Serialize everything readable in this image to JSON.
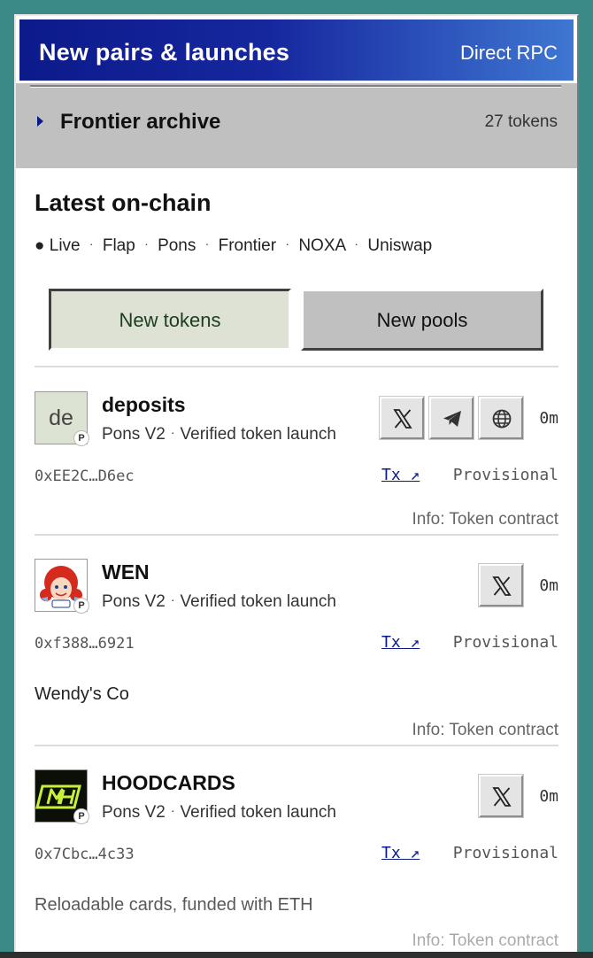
{
  "header": {
    "title": "New pairs & launches",
    "mode": "Direct RPC"
  },
  "archive": {
    "label": "Frontier archive",
    "count": "27 tokens",
    "icon": "triangle-right-icon"
  },
  "section": {
    "title": "Latest on-chain",
    "live_label": "● Live",
    "sources": [
      "Flap",
      "Pons",
      "Frontier",
      "NOXA",
      "Uniswap"
    ],
    "separator": "·"
  },
  "tabs": [
    {
      "label": "New tokens",
      "active": true
    },
    {
      "label": "New pools",
      "active": false
    }
  ],
  "tokens": [
    {
      "initials": "de",
      "badge": "P",
      "name": "deposits",
      "platform": "Pons V2",
      "kind": "Verified token launch",
      "socials": [
        "x-icon",
        "telegram-icon",
        "globe-icon"
      ],
      "age": "0m",
      "address": "0xEE2C…D6ec",
      "tx": "Tx ↗",
      "status": "Provisional",
      "description": "",
      "info": "Info: Token contract"
    },
    {
      "initials": "",
      "badge": "P",
      "name": "WEN",
      "platform": "Pons V2",
      "kind": "Verified token launch",
      "socials": [
        "x-icon"
      ],
      "age": "0m",
      "address": "0xf388…6921",
      "tx": "Tx ↗",
      "status": "Provisional",
      "description": "Wendy's Co",
      "info": "Info: Token contract"
    },
    {
      "initials": "",
      "badge": "P",
      "name": "HOODCARDS",
      "platform": "Pons V2",
      "kind": "Verified token launch",
      "socials": [
        "x-icon"
      ],
      "age": "0m",
      "address": "0x7Cbc…4c33",
      "tx": "Tx ↗",
      "status": "Provisional",
      "description": "Reloadable cards, funded with ETH",
      "info": "Info: Token contract"
    }
  ],
  "colors": {
    "titlebar_start": "#0c1a8a",
    "titlebar_end": "#3f77d2",
    "active_tab": "#dde2d4",
    "panel_gray": "#c0c0c0",
    "link": "#0a1a8a",
    "background": "#3b8a87"
  }
}
